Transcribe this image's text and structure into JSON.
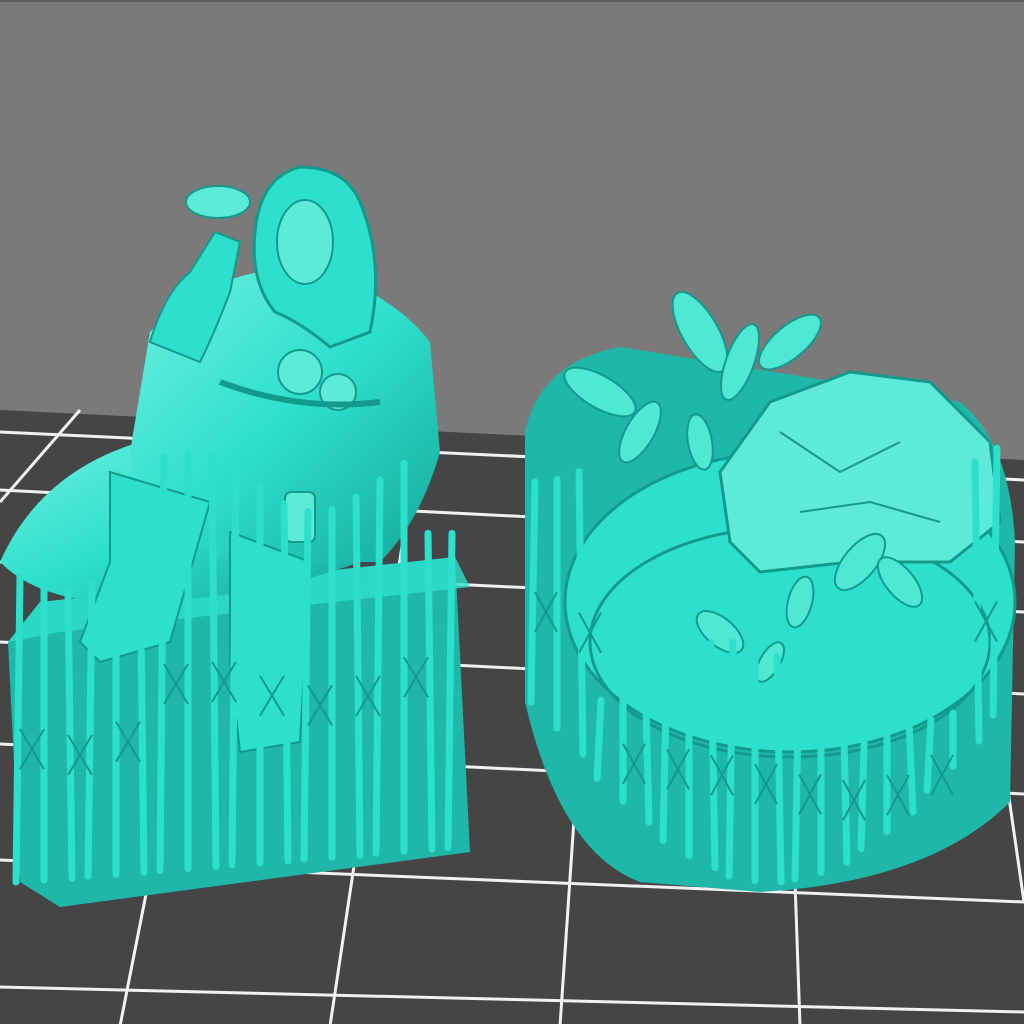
{
  "viewport": {
    "background_color": "#7a7a7a",
    "floor_color": "#454545",
    "grid_line_color": "#f2f2f2",
    "model_color": "#2de0cc",
    "model_shadow_color": "#149a8d",
    "model_highlight_color": "#7ff5e6"
  },
  "models": [
    {
      "name": "hooded-wizard-figure",
      "supports": "dense-support-tree"
    },
    {
      "name": "rocky-plant-base",
      "supports": "dense-support-tree"
    }
  ]
}
